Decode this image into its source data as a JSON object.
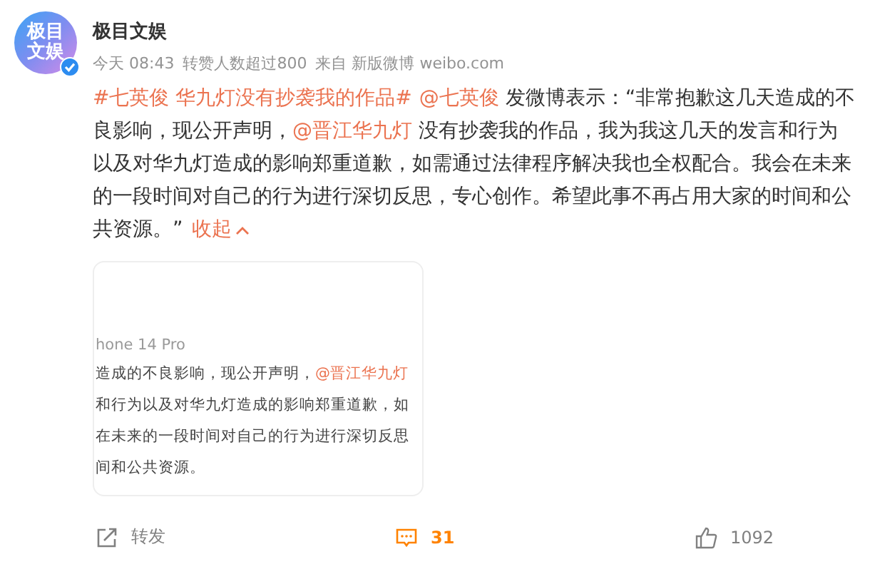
{
  "account": {
    "avatar_text": [
      "极目",
      "文娱"
    ],
    "verified": true,
    "name": "极目文娱"
  },
  "meta": [
    "今天 08:43",
    "转赞人数超过800",
    "来自 新版微博 weibo.com"
  ],
  "body": [
    {
      "kind": "topic",
      "text": "#七英俊 华九灯没有抄袭我的作品#"
    },
    {
      "kind": "mention",
      "text": "@七英俊"
    },
    {
      "kind": "text",
      "text": " 发微博表示：“非常抱歉这几天造成的不良影响，现公开声明，"
    },
    {
      "kind": "mention",
      "text": "@晋江华九灯"
    },
    {
      "kind": "text",
      "text": " 没有抄袭我的作品，我为我这几天的发言和行为以及对华九灯造成的影响郑重道歉，如需通过法律程序解决我也全权配合。我会在未来的一段时间对自己的行为进行深切反思，专心创作。希望此事不再占用大家的时间和公共资源。”"
    },
    {
      "kind": "toggle",
      "text": "收起"
    }
  ],
  "image_card": {
    "caption": "hone 14 Pro",
    "lines": [
      [
        {
          "kind": "text",
          "text": "造成的不良影响，现公开声明，"
        },
        {
          "kind": "mention",
          "text": "@晋江华九灯"
        }
      ],
      [
        {
          "kind": "text",
          "text": "和行为以及对华九灯造成的影响郑重道歉，如"
        }
      ],
      [
        {
          "kind": "text",
          "text": "在未来的一段时间对自己的行为进行深切反思"
        }
      ],
      [
        {
          "kind": "text",
          "text": "间和公共资源。"
        }
      ]
    ]
  },
  "actions": [
    {
      "kind": "repost",
      "label": "转发",
      "selected": false
    },
    {
      "kind": "comment",
      "label": "31",
      "selected": true
    },
    {
      "kind": "like",
      "label": "1092",
      "selected": false
    }
  ]
}
